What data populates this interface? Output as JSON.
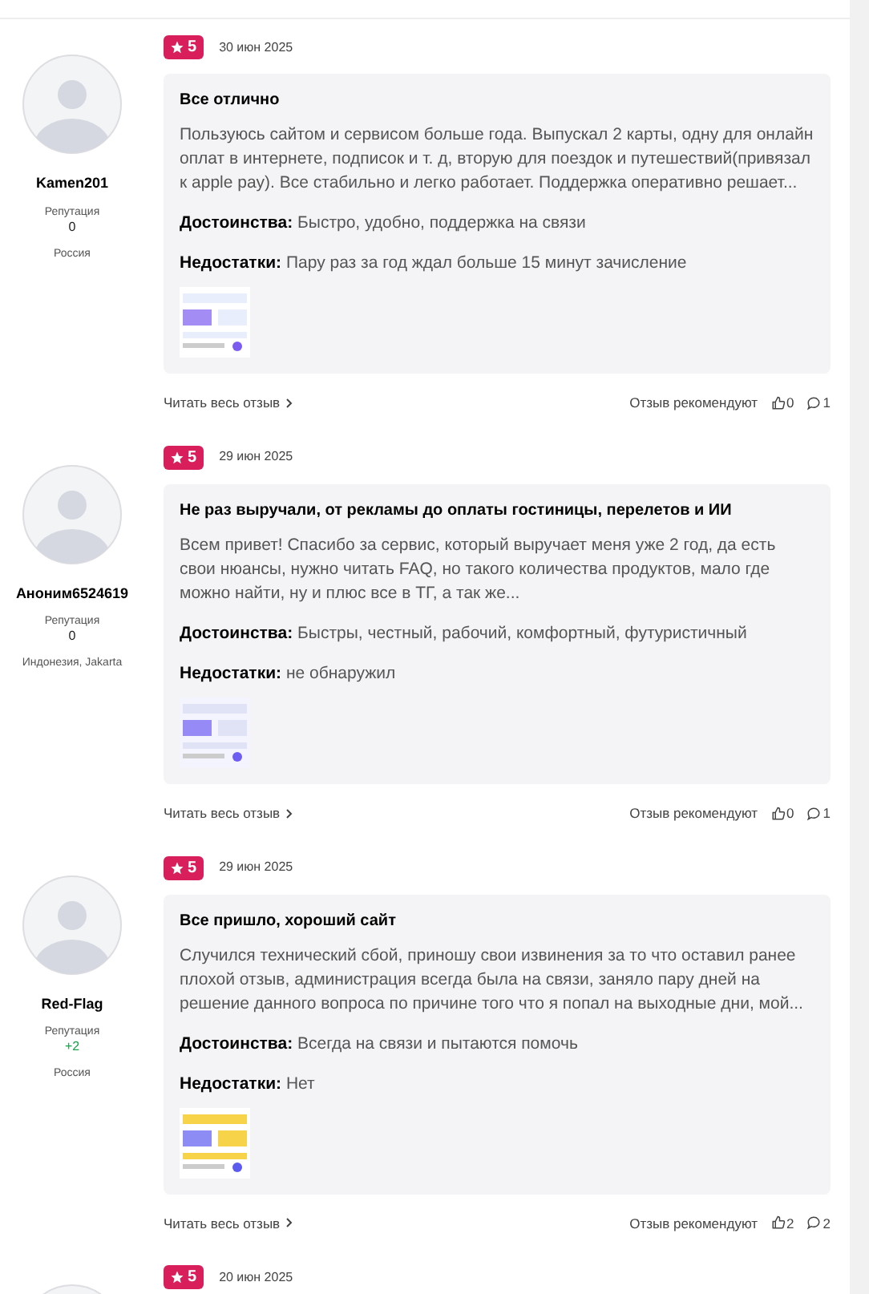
{
  "reviews": [
    {
      "rating": "5",
      "date": "30 июн 2025",
      "author": "Kamen201",
      "reputation_label": "Репутация",
      "reputation": "0",
      "reputation_positive": false,
      "location": "Россия",
      "title": "Все отлично",
      "text": "Пользуюсь сайтом и сервисом больше года. Выпускал 2 карты, одну для онлайн оплат в интернете, подписок и т. д, вторую для поездок и путешествий(привязал к apple pay). Все стабильно и легко работает. Поддержка оперативно решает...",
      "pros_label": "Достоинства:",
      "pros": "Быстро, удобно, поддержка на связи",
      "cons_label": "Недостатки:",
      "cons": "Пару раз за год ждал больше 15 минут зачисление",
      "read_more": "Читать весь отзыв",
      "recommend_label": "Отзыв рекомендуют",
      "likes": "0",
      "comments": "1"
    },
    {
      "rating": "5",
      "date": "29 июн 2025",
      "author": "Аноним6524619",
      "reputation_label": "Репутация",
      "reputation": "0",
      "reputation_positive": false,
      "location": "Индонезия, Jakarta",
      "title": "Не раз выручали, от рекламы до оплаты гостиницы, перелетов и ИИ",
      "text": "Всем привет! Спасибо за сервис, который выручает меня уже 2 год, да есть свои нюансы, нужно читать FAQ, но такого количества продуктов, мало где можно найти, ну и плюс все в ТГ, а так же...",
      "pros_label": "Достоинства:",
      "pros": "Быстры, честный, рабочий, комфортный, футуристичный",
      "cons_label": "Недостатки:",
      "cons": "не обнаружил",
      "read_more": "Читать весь отзыв",
      "recommend_label": "Отзыв рекомендуют",
      "likes": "0",
      "comments": "1"
    },
    {
      "rating": "5",
      "date": "29 июн 2025",
      "author": "Red-Flag",
      "reputation_label": "Репутация",
      "reputation": "+2",
      "reputation_positive": true,
      "location": "Россия",
      "title": "Все пришло, хороший сайт",
      "text": "Случился технический сбой, приношу свои извинения за то что оставил ранее плохой отзыв, администрация всегда была на связи, заняло пару дней на решение данного вопроса по причине того что я попал на выходные дни, мой...",
      "pros_label": "Достоинства:",
      "pros": "Всегда на связи и пытаются помочь",
      "cons_label": "Недостатки:",
      "cons": "Нет",
      "read_more": "Читать весь отзыв",
      "recommend_label": "Отзыв рекомендуют",
      "likes": "2",
      "comments": "2"
    },
    {
      "rating": "5",
      "date": "20 июн 2025"
    }
  ]
}
